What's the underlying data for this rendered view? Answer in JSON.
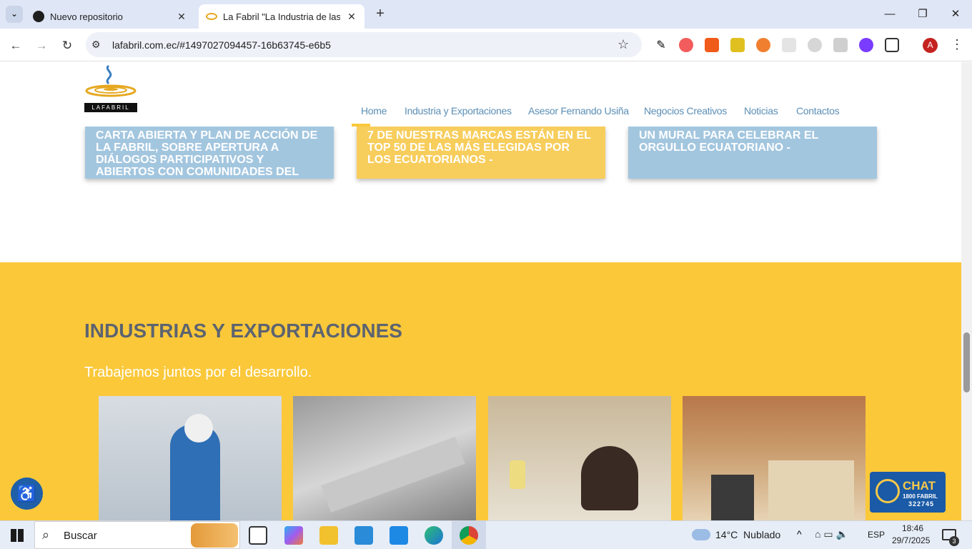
{
  "browser": {
    "tabs": [
      {
        "title": "Nuevo repositorio",
        "active": false
      },
      {
        "title": "La Fabril \"La Industria de las Ide",
        "active": true
      }
    ],
    "url": "lafabril.com.ec/#1497027094457-16b63745-e6b5",
    "profile_initial": "A"
  },
  "site": {
    "logo_text": "LAFABRIL",
    "nav": [
      "Home",
      "Industria y Exportaciones",
      "Asesor Fernando Usiña",
      "Negocios Creativos",
      "Noticias",
      "Contactos"
    ],
    "cards": [
      {
        "text": "CARTA ABIERTA Y PLAN DE ACCIÓN DE LA FABRIL, SOBRE APERTURA A DIÁLOGOS PARTICIPATIVOS Y ABIERTOS CON COMUNIDADES DEL",
        "color": "#a3c6df"
      },
      {
        "text": "7 DE NUESTRAS MARCAS ESTÁN EN EL TOP 50 DE LAS MÁS ELEGIDAS POR LOS ECUATORIANOS -",
        "color": "#f7cd5c"
      },
      {
        "text": "UN MURAL PARA CELEBRAR EL ORGULLO ECUATORIANO -",
        "color": "#a3c6df"
      }
    ],
    "section_title": "INDUSTRIAS Y EXPORTACIONES",
    "section_subtitle": "Trabajemos juntos por el desarrollo.",
    "chat": {
      "label": "CHAT",
      "phone_top": "1800 FABRIL",
      "phone_bottom": "322745"
    }
  },
  "taskbar": {
    "search_placeholder": "Buscar",
    "weather": "14°C  Nublado",
    "lang": "ESP",
    "time": "18:46",
    "date": "29/7/2025",
    "notifications": "3"
  },
  "colors": {
    "accent": "#fbc83a",
    "nav": "#5b8fb6",
    "title": "#5d6470"
  }
}
